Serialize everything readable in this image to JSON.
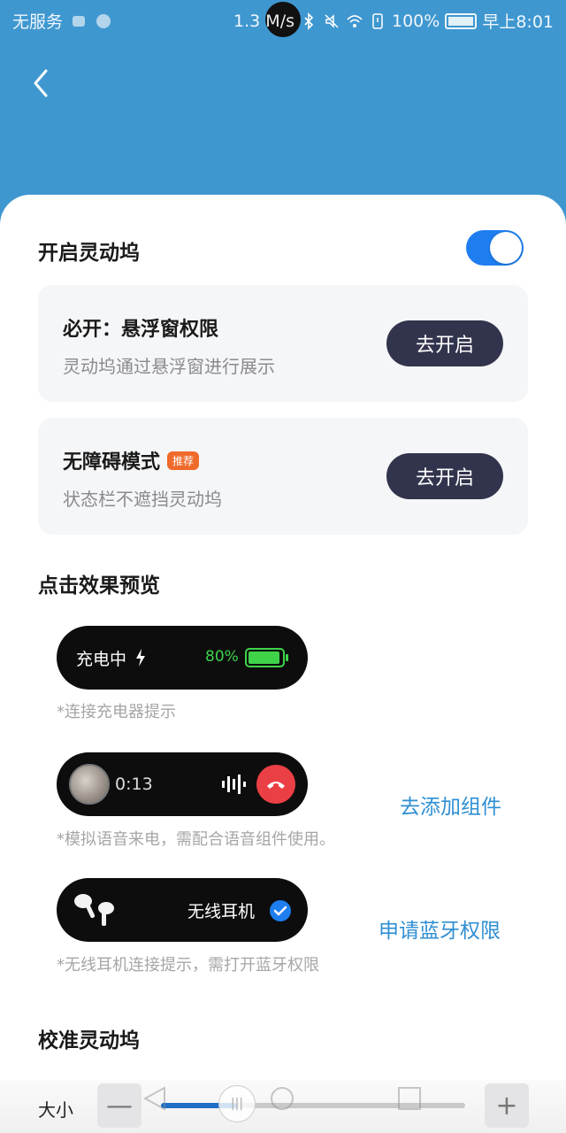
{
  "status_bar": {
    "carrier": "无服务",
    "speed": "1.3 M/s",
    "battery": "100%",
    "time": "早上8:01"
  },
  "main": {
    "enable_label": "开启灵动坞",
    "enable_on": true,
    "cards": [
      {
        "title": "必开：悬浮窗权限",
        "subtitle": "灵动坞通过悬浮窗进行展示",
        "button": "去开启",
        "badge": ""
      },
      {
        "title": "无障碍模式",
        "subtitle": "状态栏不遮挡灵动坞",
        "button": "去开启",
        "badge": "推荐"
      }
    ],
    "preview_title": "点击效果预览",
    "previews": [
      {
        "label": "充电中",
        "value": "80%",
        "hint": "*连接充电器提示"
      },
      {
        "value": "0:13",
        "hint": "*模拟语音来电，需配合语音组件使用。",
        "link": "去添加组件"
      },
      {
        "label": "无线耳机",
        "hint": "*无线耳机连接提示，需打开蓝牙权限",
        "link": "申请蓝牙权限"
      }
    ],
    "calibrate_title": "校准灵动坞",
    "size_label": "大小",
    "minus_label": "—",
    "plus_label": "+",
    "size_level": 0.25
  },
  "colors": {
    "header_bg": "#3f97d0",
    "accent": "#1e7ef0",
    "dark_button": "#32344d",
    "link": "#2f8fd3",
    "battery_green": "#3fd34a",
    "call_red": "#ea3f45",
    "badge_orange": "#ef6a2b"
  }
}
